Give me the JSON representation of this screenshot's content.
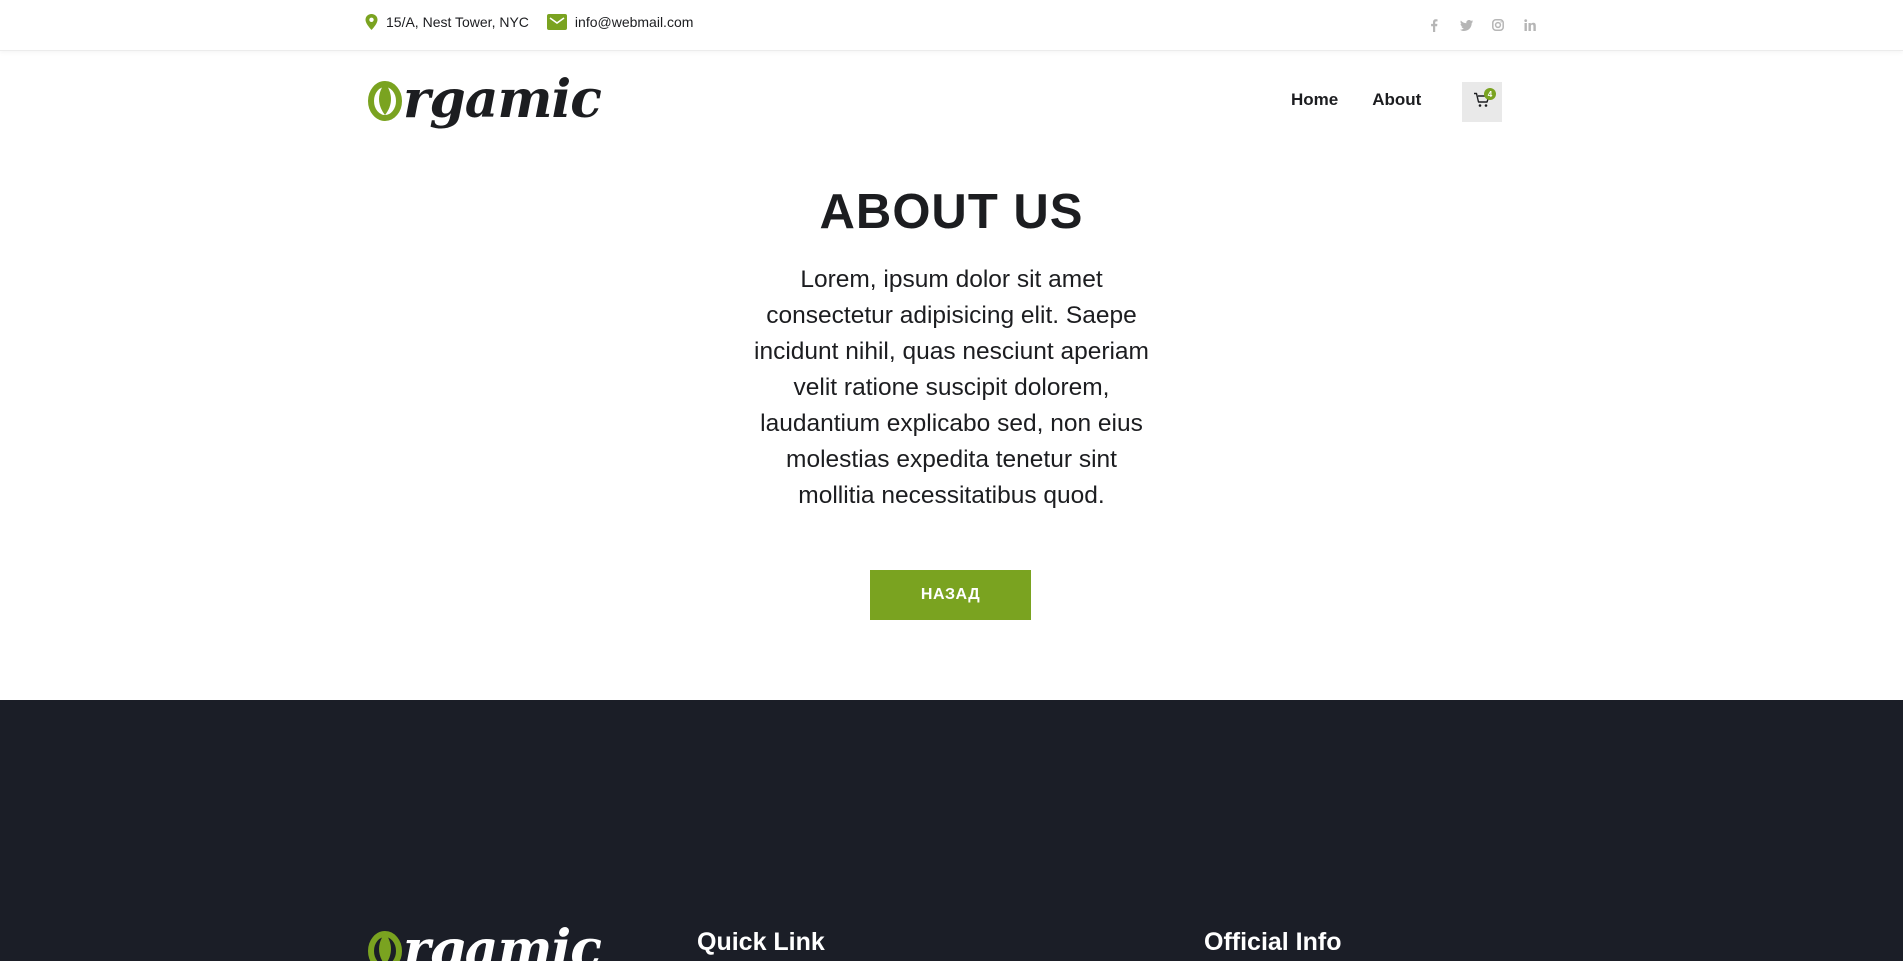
{
  "topbar": {
    "address": "15/A, Nest Tower, NYC",
    "email": "info@webmail.com",
    "social_icons": [
      "facebook-icon",
      "twitter-icon",
      "instagram-icon",
      "linkedin-icon"
    ]
  },
  "header": {
    "logo_first": "O",
    "logo_rest": "rgamic",
    "nav": [
      "Home",
      "About"
    ],
    "cart_count": "4"
  },
  "main": {
    "title": "ABOUT US",
    "text": "Lorem, ipsum dolor sit amet consectetur adipisicing elit. Saepe incidunt nihil, quas nesciunt aperiam velit ratione suscipit dolorem, laudantium explicabo sed, non eius molestias expedita tenetur sint mollitia necessitatibus quod.",
    "back_label": "НАЗАД"
  },
  "footer": {
    "logo_first": "O",
    "logo_rest": "rgamic",
    "quick_link_heading": "Quick Link",
    "official_info_heading": "Official Info"
  },
  "colors": {
    "accent": "#7aa320",
    "footer_bg": "#1b1e27",
    "text": "#1c1d20"
  }
}
